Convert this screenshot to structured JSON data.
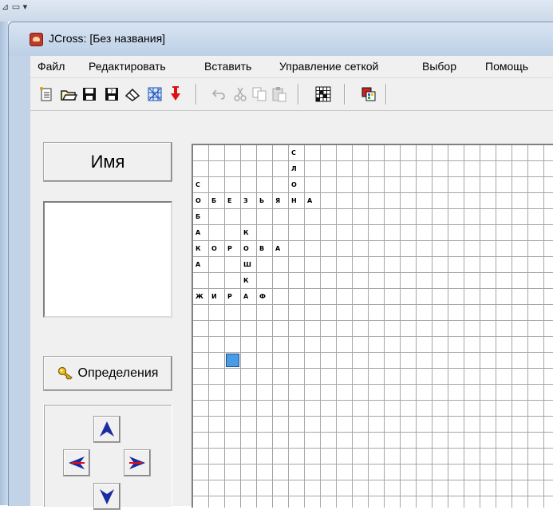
{
  "window": {
    "title": "JCross: [Без названия]"
  },
  "menu": [
    "Файл",
    "Редактировать",
    "Вставить",
    "Управление сеткой",
    "Выбор",
    "Помощь"
  ],
  "toolbar": {
    "icons": [
      "new-file-icon",
      "open-folder-icon",
      "save-icon",
      "save-as-icon",
      "erase-icon",
      "generate-grid-icon",
      "down-arrow-icon",
      "undo-icon",
      "cut-icon",
      "copy-icon",
      "paste-icon",
      "grid-icon",
      "palette-icon"
    ]
  },
  "left_panel": {
    "name_label": "Имя",
    "clue_text": "",
    "definitions_label": "Определения"
  },
  "grid": {
    "cols": 23,
    "rows": 23,
    "cursor": {
      "row": 13,
      "col": 2
    },
    "letters": [
      {
        "row": 0,
        "col": 6,
        "ch": "С"
      },
      {
        "row": 1,
        "col": 6,
        "ch": "Л"
      },
      {
        "row": 2,
        "col": 0,
        "ch": "С"
      },
      {
        "row": 2,
        "col": 6,
        "ch": "О"
      },
      {
        "row": 3,
        "col": 0,
        "ch": "О"
      },
      {
        "row": 3,
        "col": 1,
        "ch": "Б"
      },
      {
        "row": 3,
        "col": 2,
        "ch": "Е"
      },
      {
        "row": 3,
        "col": 3,
        "ch": "З"
      },
      {
        "row": 3,
        "col": 4,
        "ch": "Ь"
      },
      {
        "row": 3,
        "col": 5,
        "ch": "Я"
      },
      {
        "row": 3,
        "col": 6,
        "ch": "Н"
      },
      {
        "row": 3,
        "col": 7,
        "ch": "А"
      },
      {
        "row": 4,
        "col": 0,
        "ch": "Б"
      },
      {
        "row": 5,
        "col": 0,
        "ch": "А"
      },
      {
        "row": 5,
        "col": 3,
        "ch": "К"
      },
      {
        "row": 6,
        "col": 0,
        "ch": "К"
      },
      {
        "row": 6,
        "col": 1,
        "ch": "О"
      },
      {
        "row": 6,
        "col": 2,
        "ch": "Р"
      },
      {
        "row": 6,
        "col": 3,
        "ch": "О"
      },
      {
        "row": 6,
        "col": 4,
        "ch": "В"
      },
      {
        "row": 6,
        "col": 5,
        "ch": "А"
      },
      {
        "row": 7,
        "col": 0,
        "ch": "А"
      },
      {
        "row": 7,
        "col": 3,
        "ch": "Ш"
      },
      {
        "row": 8,
        "col": 3,
        "ch": "К"
      },
      {
        "row": 9,
        "col": 0,
        "ch": "Ж"
      },
      {
        "row": 9,
        "col": 1,
        "ch": "И"
      },
      {
        "row": 9,
        "col": 2,
        "ch": "Р"
      },
      {
        "row": 9,
        "col": 3,
        "ch": "А"
      },
      {
        "row": 9,
        "col": 4,
        "ch": "Ф"
      }
    ]
  }
}
